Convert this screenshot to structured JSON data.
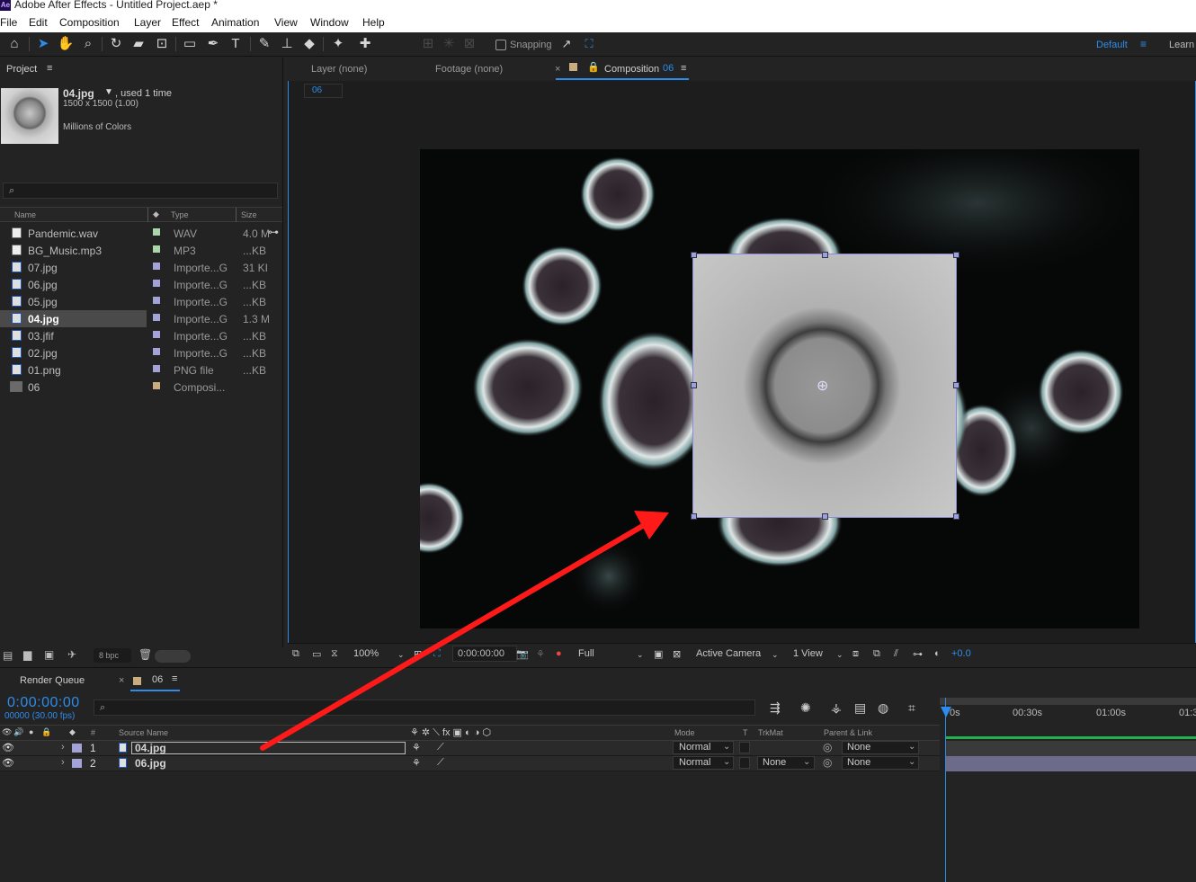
{
  "app": {
    "title": "Adobe After Effects - Untitled Project.aep *",
    "logo_text": "Ae"
  },
  "menu": [
    "File",
    "Edit",
    "Composition",
    "Layer",
    "Effect",
    "Animation",
    "View",
    "Window",
    "Help"
  ],
  "toolbar": {
    "snapping_label": "Snapping",
    "workspace_label": "Default",
    "workspace_menu_icon": "≡",
    "learn_label": "Learn"
  },
  "project": {
    "tab_label": "Project",
    "tab_menu_icon": "≡",
    "selected_name": "04.jpg",
    "selected_used": ", used 1 time",
    "selected_dims": "1500 x 1500 (1.00)",
    "selected_colors": "Millions of Colors",
    "search_icon": "⌕",
    "columns": {
      "name": "Name",
      "type": "Type",
      "size": "Size"
    },
    "items": [
      {
        "name": "Pandemic.wav",
        "type": "WAV",
        "size": "4.0 M",
        "swatch": "#a9d7a9",
        "icon": "audio-file-icon"
      },
      {
        "name": "BG_Music.mp3",
        "type": "MP3",
        "size": "...KB",
        "swatch": "#a9d7a9",
        "icon": "audio-file-icon"
      },
      {
        "name": "07.jpg",
        "type": "Importe...G",
        "size": "31 KI",
        "swatch": "#a3a3d8",
        "icon": "image-file-icon"
      },
      {
        "name": "06.jpg",
        "type": "Importe...G",
        "size": "...KB",
        "swatch": "#a3a3d8",
        "icon": "image-file-icon"
      },
      {
        "name": "05.jpg",
        "type": "Importe...G",
        "size": "...KB",
        "swatch": "#a3a3d8",
        "icon": "image-file-icon"
      },
      {
        "name": "04.jpg",
        "type": "Importe...G",
        "size": "1.3 M",
        "swatch": "#a3a3d8",
        "icon": "image-file-icon"
      },
      {
        "name": "03.jfif",
        "type": "Importe...G",
        "size": "...KB",
        "swatch": "#a3a3d8",
        "icon": "image-file-icon"
      },
      {
        "name": "02.jpg",
        "type": "Importe...G",
        "size": "...KB",
        "swatch": "#a3a3d8",
        "icon": "image-file-icon"
      },
      {
        "name": "01.png",
        "type": "PNG file",
        "size": "...KB",
        "swatch": "#a3a3d8",
        "icon": "image-file-icon"
      },
      {
        "name": "06",
        "type": "Composi...",
        "size": "",
        "swatch": "#c9ad7e",
        "icon": "composition-icon"
      }
    ],
    "bpc_label": "8 bpc"
  },
  "viewer": {
    "tab_layer": "Layer  (none)",
    "tab_footage": "Footage  (none)",
    "tab_comp_prefix": "Composition",
    "tab_comp_name": "06",
    "tab_menu_icon": "≡",
    "comp_chip": "06",
    "zoom": "100%",
    "timecode": "0:00:00:00",
    "resolution": "Full",
    "camera": "Active Camera",
    "views": "1 View",
    "exposure": "+0.0"
  },
  "timeline": {
    "render_queue_label": "Render Queue",
    "comp_tab_label": "06",
    "tab_menu_icon": "≡",
    "timecode": "0:00:00:00",
    "fps": "00000 (30.00 fps)",
    "search_icon": "⌕",
    "columns": {
      "hash": "#",
      "source_name": "Source Name",
      "mode": "Mode",
      "t": "T",
      "trkmat": "TrkMat",
      "parent": "Parent & Link"
    },
    "layers": [
      {
        "num": "1",
        "name": "04.jpg",
        "mode": "Normal",
        "trkmat": "",
        "parent": "None"
      },
      {
        "num": "2",
        "name": "06.jpg",
        "mode": "Normal",
        "trkmat": "None",
        "parent": "None"
      }
    ],
    "ruler": [
      "0s",
      "00:30s",
      "01:00s",
      "01:3"
    ]
  },
  "colors": {
    "accent": "#2d8ceb",
    "annotation_arrow": "#ff1a1a",
    "work_area": "#22b14c"
  }
}
